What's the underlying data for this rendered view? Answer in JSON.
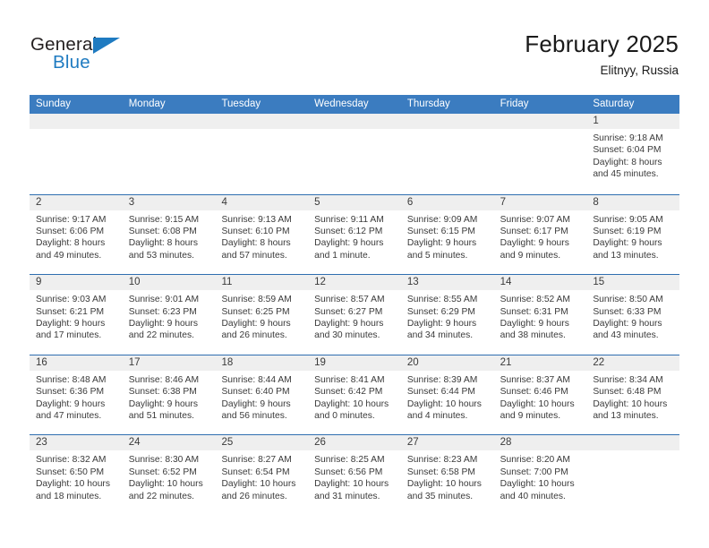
{
  "brand": {
    "name_part1": "General",
    "name_part2": "Blue",
    "flag_icon": "blue-triangle-flag-icon",
    "color_primary": "#1f7bc1",
    "color_dark": "#231f20"
  },
  "header": {
    "title": "February 2025",
    "location": "Elitnyy, Russia"
  },
  "theme": {
    "header_blue": "#3b7cc0",
    "rule_blue": "#2f6eb0",
    "day_band_gray": "#efefef",
    "text_gray": "#3a3a3a"
  },
  "weekdays": [
    "Sunday",
    "Monday",
    "Tuesday",
    "Wednesday",
    "Thursday",
    "Friday",
    "Saturday"
  ],
  "labels": {
    "sunrise": "Sunrise:",
    "sunset": "Sunset:",
    "daylight": "Daylight:"
  },
  "weeks": [
    [
      {
        "day": "",
        "blank": true
      },
      {
        "day": "",
        "blank": true
      },
      {
        "day": "",
        "blank": true
      },
      {
        "day": "",
        "blank": true
      },
      {
        "day": "",
        "blank": true
      },
      {
        "day": "",
        "blank": true
      },
      {
        "day": "1",
        "sunrise": "Sunrise: 9:18 AM",
        "sunset": "Sunset: 6:04 PM",
        "daylight_l1": "Daylight: 8 hours",
        "daylight_l2": "and 45 minutes."
      }
    ],
    [
      {
        "day": "2",
        "sunrise": "Sunrise: 9:17 AM",
        "sunset": "Sunset: 6:06 PM",
        "daylight_l1": "Daylight: 8 hours",
        "daylight_l2": "and 49 minutes."
      },
      {
        "day": "3",
        "sunrise": "Sunrise: 9:15 AM",
        "sunset": "Sunset: 6:08 PM",
        "daylight_l1": "Daylight: 8 hours",
        "daylight_l2": "and 53 minutes."
      },
      {
        "day": "4",
        "sunrise": "Sunrise: 9:13 AM",
        "sunset": "Sunset: 6:10 PM",
        "daylight_l1": "Daylight: 8 hours",
        "daylight_l2": "and 57 minutes."
      },
      {
        "day": "5",
        "sunrise": "Sunrise: 9:11 AM",
        "sunset": "Sunset: 6:12 PM",
        "daylight_l1": "Daylight: 9 hours",
        "daylight_l2": "and 1 minute."
      },
      {
        "day": "6",
        "sunrise": "Sunrise: 9:09 AM",
        "sunset": "Sunset: 6:15 PM",
        "daylight_l1": "Daylight: 9 hours",
        "daylight_l2": "and 5 minutes."
      },
      {
        "day": "7",
        "sunrise": "Sunrise: 9:07 AM",
        "sunset": "Sunset: 6:17 PM",
        "daylight_l1": "Daylight: 9 hours",
        "daylight_l2": "and 9 minutes."
      },
      {
        "day": "8",
        "sunrise": "Sunrise: 9:05 AM",
        "sunset": "Sunset: 6:19 PM",
        "daylight_l1": "Daylight: 9 hours",
        "daylight_l2": "and 13 minutes."
      }
    ],
    [
      {
        "day": "9",
        "sunrise": "Sunrise: 9:03 AM",
        "sunset": "Sunset: 6:21 PM",
        "daylight_l1": "Daylight: 9 hours",
        "daylight_l2": "and 17 minutes."
      },
      {
        "day": "10",
        "sunrise": "Sunrise: 9:01 AM",
        "sunset": "Sunset: 6:23 PM",
        "daylight_l1": "Daylight: 9 hours",
        "daylight_l2": "and 22 minutes."
      },
      {
        "day": "11",
        "sunrise": "Sunrise: 8:59 AM",
        "sunset": "Sunset: 6:25 PM",
        "daylight_l1": "Daylight: 9 hours",
        "daylight_l2": "and 26 minutes."
      },
      {
        "day": "12",
        "sunrise": "Sunrise: 8:57 AM",
        "sunset": "Sunset: 6:27 PM",
        "daylight_l1": "Daylight: 9 hours",
        "daylight_l2": "and 30 minutes."
      },
      {
        "day": "13",
        "sunrise": "Sunrise: 8:55 AM",
        "sunset": "Sunset: 6:29 PM",
        "daylight_l1": "Daylight: 9 hours",
        "daylight_l2": "and 34 minutes."
      },
      {
        "day": "14",
        "sunrise": "Sunrise: 8:52 AM",
        "sunset": "Sunset: 6:31 PM",
        "daylight_l1": "Daylight: 9 hours",
        "daylight_l2": "and 38 minutes."
      },
      {
        "day": "15",
        "sunrise": "Sunrise: 8:50 AM",
        "sunset": "Sunset: 6:33 PM",
        "daylight_l1": "Daylight: 9 hours",
        "daylight_l2": "and 43 minutes."
      }
    ],
    [
      {
        "day": "16",
        "sunrise": "Sunrise: 8:48 AM",
        "sunset": "Sunset: 6:36 PM",
        "daylight_l1": "Daylight: 9 hours",
        "daylight_l2": "and 47 minutes."
      },
      {
        "day": "17",
        "sunrise": "Sunrise: 8:46 AM",
        "sunset": "Sunset: 6:38 PM",
        "daylight_l1": "Daylight: 9 hours",
        "daylight_l2": "and 51 minutes."
      },
      {
        "day": "18",
        "sunrise": "Sunrise: 8:44 AM",
        "sunset": "Sunset: 6:40 PM",
        "daylight_l1": "Daylight: 9 hours",
        "daylight_l2": "and 56 minutes."
      },
      {
        "day": "19",
        "sunrise": "Sunrise: 8:41 AM",
        "sunset": "Sunset: 6:42 PM",
        "daylight_l1": "Daylight: 10 hours",
        "daylight_l2": "and 0 minutes."
      },
      {
        "day": "20",
        "sunrise": "Sunrise: 8:39 AM",
        "sunset": "Sunset: 6:44 PM",
        "daylight_l1": "Daylight: 10 hours",
        "daylight_l2": "and 4 minutes."
      },
      {
        "day": "21",
        "sunrise": "Sunrise: 8:37 AM",
        "sunset": "Sunset: 6:46 PM",
        "daylight_l1": "Daylight: 10 hours",
        "daylight_l2": "and 9 minutes."
      },
      {
        "day": "22",
        "sunrise": "Sunrise: 8:34 AM",
        "sunset": "Sunset: 6:48 PM",
        "daylight_l1": "Daylight: 10 hours",
        "daylight_l2": "and 13 minutes."
      }
    ],
    [
      {
        "day": "23",
        "sunrise": "Sunrise: 8:32 AM",
        "sunset": "Sunset: 6:50 PM",
        "daylight_l1": "Daylight: 10 hours",
        "daylight_l2": "and 18 minutes."
      },
      {
        "day": "24",
        "sunrise": "Sunrise: 8:30 AM",
        "sunset": "Sunset: 6:52 PM",
        "daylight_l1": "Daylight: 10 hours",
        "daylight_l2": "and 22 minutes."
      },
      {
        "day": "25",
        "sunrise": "Sunrise: 8:27 AM",
        "sunset": "Sunset: 6:54 PM",
        "daylight_l1": "Daylight: 10 hours",
        "daylight_l2": "and 26 minutes."
      },
      {
        "day": "26",
        "sunrise": "Sunrise: 8:25 AM",
        "sunset": "Sunset: 6:56 PM",
        "daylight_l1": "Daylight: 10 hours",
        "daylight_l2": "and 31 minutes."
      },
      {
        "day": "27",
        "sunrise": "Sunrise: 8:23 AM",
        "sunset": "Sunset: 6:58 PM",
        "daylight_l1": "Daylight: 10 hours",
        "daylight_l2": "and 35 minutes."
      },
      {
        "day": "28",
        "sunrise": "Sunrise: 8:20 AM",
        "sunset": "Sunset: 7:00 PM",
        "daylight_l1": "Daylight: 10 hours",
        "daylight_l2": "and 40 minutes."
      },
      {
        "day": "",
        "blank": true
      }
    ]
  ]
}
